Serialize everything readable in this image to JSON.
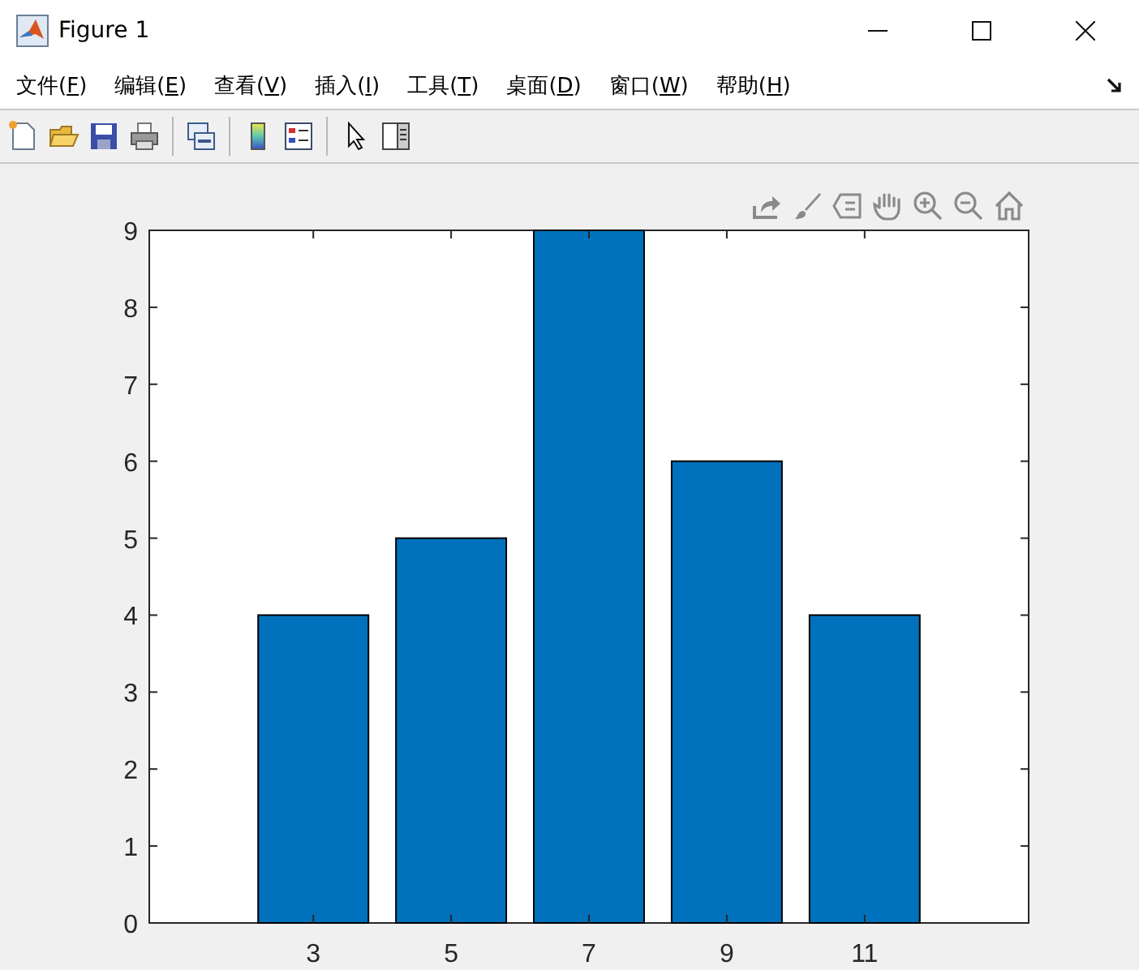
{
  "window": {
    "title": "Figure 1"
  },
  "menu": [
    {
      "before": "文件(",
      "accel": "F",
      "after": ")"
    },
    {
      "before": "编辑(",
      "accel": "E",
      "after": ")"
    },
    {
      "before": "查看(",
      "accel": "V",
      "after": ")"
    },
    {
      "before": "插入(",
      "accel": "I",
      "after": ")"
    },
    {
      "before": "工具(",
      "accel": "T",
      "after": ")"
    },
    {
      "before": "桌面(",
      "accel": "D",
      "after": ")"
    },
    {
      "before": "窗口(",
      "accel": "W",
      "after": ")"
    },
    {
      "before": "帮助(",
      "accel": "H",
      "after": ")"
    }
  ],
  "figure": {
    "chart_data": {
      "type": "bar",
      "x": [
        3,
        5,
        7,
        9,
        11
      ],
      "values": [
        4,
        5,
        9,
        6,
        4
      ],
      "xlim": [
        0.62,
        13.38
      ],
      "ylim": [
        0,
        9
      ],
      "xticks": [
        3,
        5,
        7,
        9,
        11
      ],
      "yticks": [
        0,
        1,
        2,
        3,
        4,
        5,
        6,
        7,
        8,
        9
      ]
    }
  }
}
